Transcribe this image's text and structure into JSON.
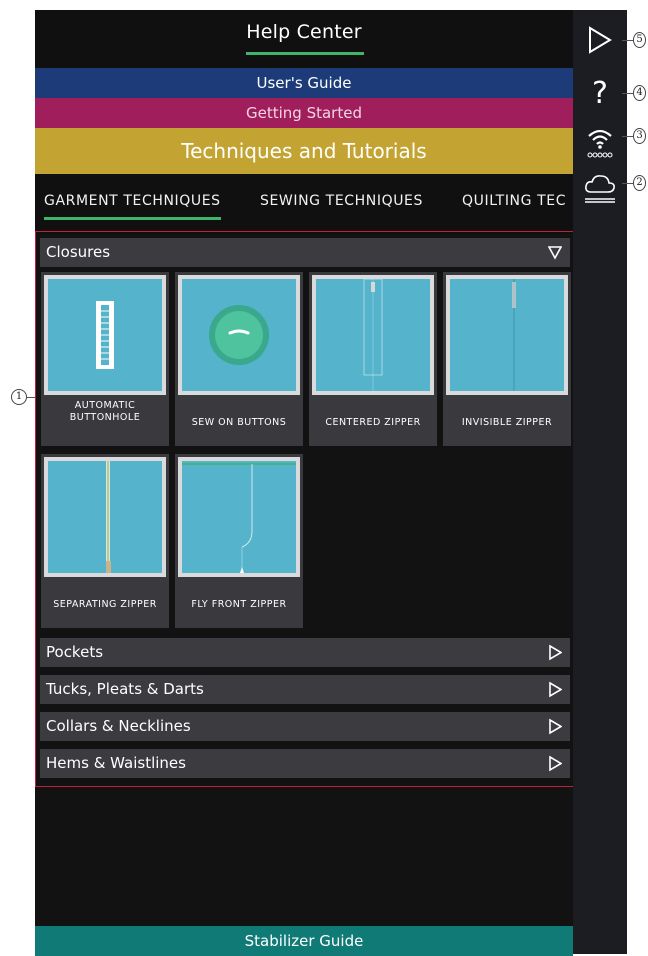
{
  "header": {
    "title": "Help Center"
  },
  "bands": {
    "users_guide": "User's Guide",
    "getting_started": "Getting Started",
    "techniques": "Techniques and Tutorials"
  },
  "tabs": [
    {
      "label": "GARMENT TECHNIQUES",
      "active": true
    },
    {
      "label": "SEWING TECHNIQUES",
      "active": false
    },
    {
      "label": "QUILTING TEC",
      "active": false
    }
  ],
  "sections": {
    "closures": {
      "label": "Closures",
      "expanded": true
    },
    "pockets": {
      "label": "Pockets"
    },
    "tucks": {
      "label": "Tucks, Pleats & Darts"
    },
    "collars": {
      "label": "Collars & Necklines"
    },
    "hems": {
      "label": "Hems & Waistlines"
    }
  },
  "tiles": [
    {
      "label": "AUTOMATIC\nBUTTONHOLE"
    },
    {
      "label": "SEW ON BUTTONS"
    },
    {
      "label": "CENTERED ZIPPER"
    },
    {
      "label": "INVISIBLE ZIPPER"
    },
    {
      "label": "SEPARATING ZIPPER"
    },
    {
      "label": "FLY FRONT ZIPPER"
    }
  ],
  "footer": {
    "stabilizer_guide": "Stabilizer Guide"
  },
  "rail_icons": [
    "play-icon",
    "help-icon",
    "wifi-icon",
    "cloud-icon"
  ],
  "callouts": [
    "1",
    "2",
    "3",
    "4",
    "5"
  ],
  "colors": {
    "accent_green": "#3fb46a",
    "users_guide_blue": "#1d3b78",
    "getting_started_magenta": "#a01e5c",
    "techniques_gold": "#c3a433",
    "stabilizer_teal": "#0f7a76",
    "frame_red": "#c21f3a",
    "fabric_blue": "#55b3cb"
  }
}
